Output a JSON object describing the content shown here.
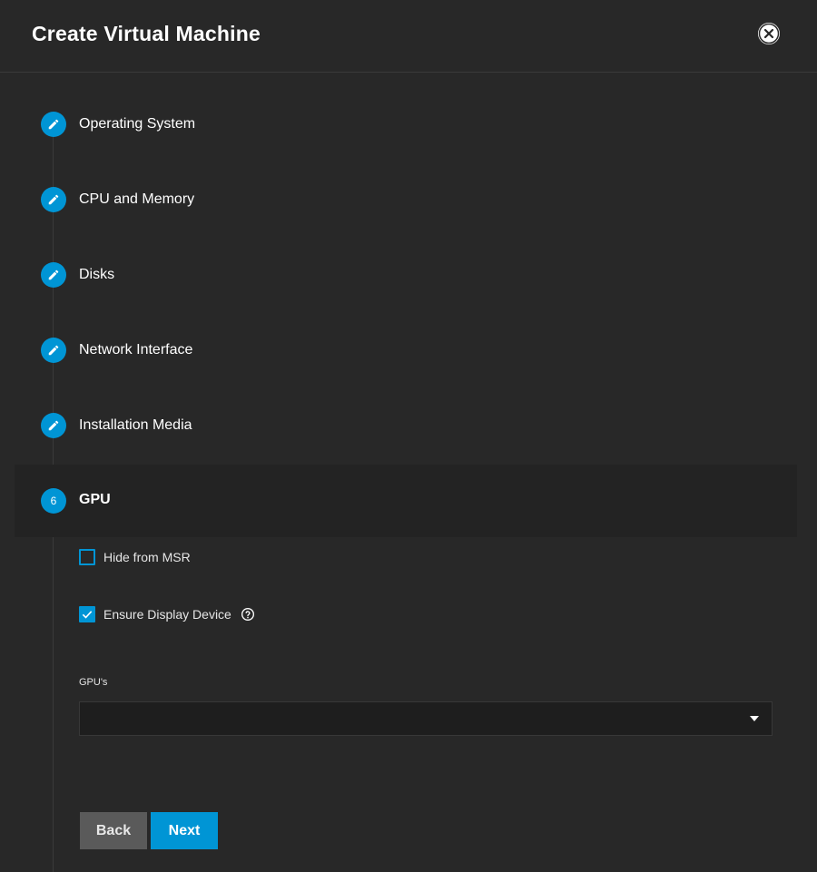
{
  "dialog": {
    "title": "Create Virtual Machine",
    "close_icon": "close-icon"
  },
  "steps": [
    {
      "label": "Operating System",
      "icon": "pencil-icon"
    },
    {
      "label": "CPU and Memory",
      "icon": "pencil-icon"
    },
    {
      "label": "Disks",
      "icon": "pencil-icon"
    },
    {
      "label": "Network Interface",
      "icon": "pencil-icon"
    },
    {
      "label": "Installation Media",
      "icon": "pencil-icon"
    },
    {
      "label": "GPU",
      "number": "6",
      "active": true
    }
  ],
  "gpu_form": {
    "hide_from_msr": {
      "label": "Hide from MSR",
      "checked": false
    },
    "ensure_display_device": {
      "label": "Ensure Display Device",
      "checked": true,
      "help_icon": "help-icon"
    },
    "gpus": {
      "label": "GPU's",
      "value": ""
    }
  },
  "actions": {
    "back_label": "Back",
    "next_label": "Next"
  },
  "colors": {
    "accent": "#0095d5",
    "background": "#282828",
    "active_step_bg": "#232323",
    "back_button": "#5a5a5a"
  }
}
